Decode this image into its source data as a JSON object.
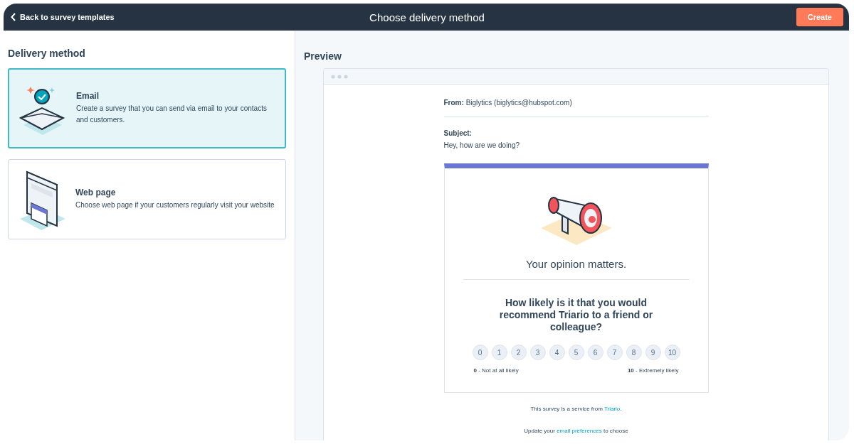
{
  "header": {
    "back_link": "Back to survey templates",
    "title": "Choose delivery method",
    "create_button": "Create"
  },
  "delivery": {
    "heading": "Delivery method",
    "options": [
      {
        "kind": "email",
        "title": "Email",
        "description": "Create a survey that you can send via email to your contacts and customers.",
        "selected": true
      },
      {
        "kind": "web",
        "title": "Web page",
        "description": "Choose web page if your customers regularly visit your website",
        "selected": false
      }
    ]
  },
  "preview": {
    "heading": "Preview",
    "from_label": "From:",
    "from_value": "Biglytics (biglytics@hubspot.com)",
    "subject_label": "Subject:",
    "subject_value": "Hey, how are we doing?",
    "headline": "Your opinion matters.",
    "question": "How likely is it that you would recommend Triario to a friend or colleague?",
    "scale": [
      "0",
      "1",
      "2",
      "3",
      "4",
      "5",
      "6",
      "7",
      "8",
      "9",
      "10"
    ],
    "low_label": "**0** - Not at all likely",
    "high_label": "**10** - Extremely likely",
    "footer": {
      "before": "This survey is a service from ",
      "link": "Triario",
      "after": "."
    },
    "preferences": {
      "before": "Update your ",
      "link": "email preferences",
      "after": " to choose"
    }
  }
}
